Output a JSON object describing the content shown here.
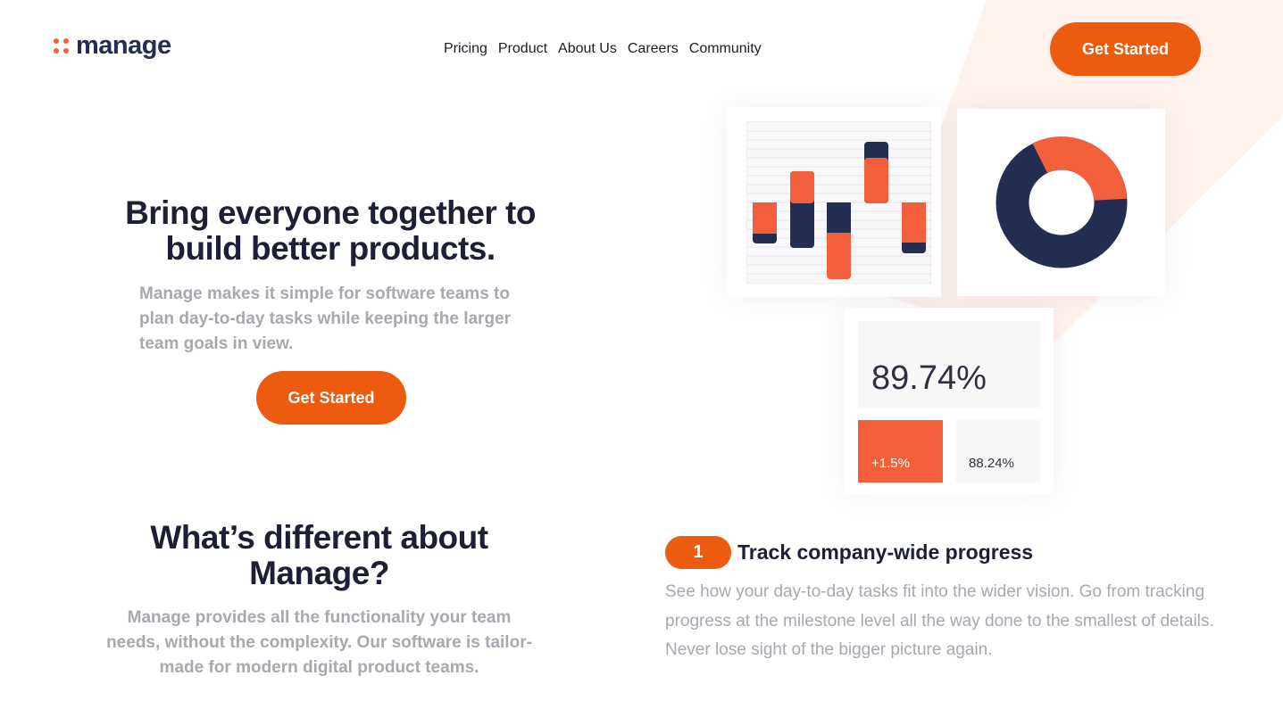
{
  "logo": {
    "text": "manage"
  },
  "nav": [
    "Pricing",
    "Product",
    "About Us",
    "Careers",
    "Community"
  ],
  "header": {
    "cta_label": "Get Started"
  },
  "hero": {
    "title": "Bring everyone together to build better products.",
    "description": "Manage makes it simple for software teams to plan day-to-day tasks while keeping the larger team goals in view.",
    "cta_label": "Get Started"
  },
  "illustration": {
    "stat_main": "89.74%",
    "stat_change": "+1.5%",
    "stat_secondary": "88.24%"
  },
  "different": {
    "title": "What’s different about Manage?",
    "description": "Manage provides all the functionality your team needs, without the complexity. Our software is tailor-made for modern digital product teams."
  },
  "feature": {
    "number": "1",
    "title": "Track company-wide progress",
    "description": "See how your day-to-day tasks fit into the wider vision. Go from tracking progress at the milestone level all the way done to the smallest of details. Never lose sight of the bigger picture again."
  },
  "colors": {
    "accent": "#ec5b0f",
    "navy": "#242d52",
    "coral": "#f25f3a",
    "pale": "#fff1ec"
  },
  "icons": {
    "logo": "dots-logo-icon"
  }
}
